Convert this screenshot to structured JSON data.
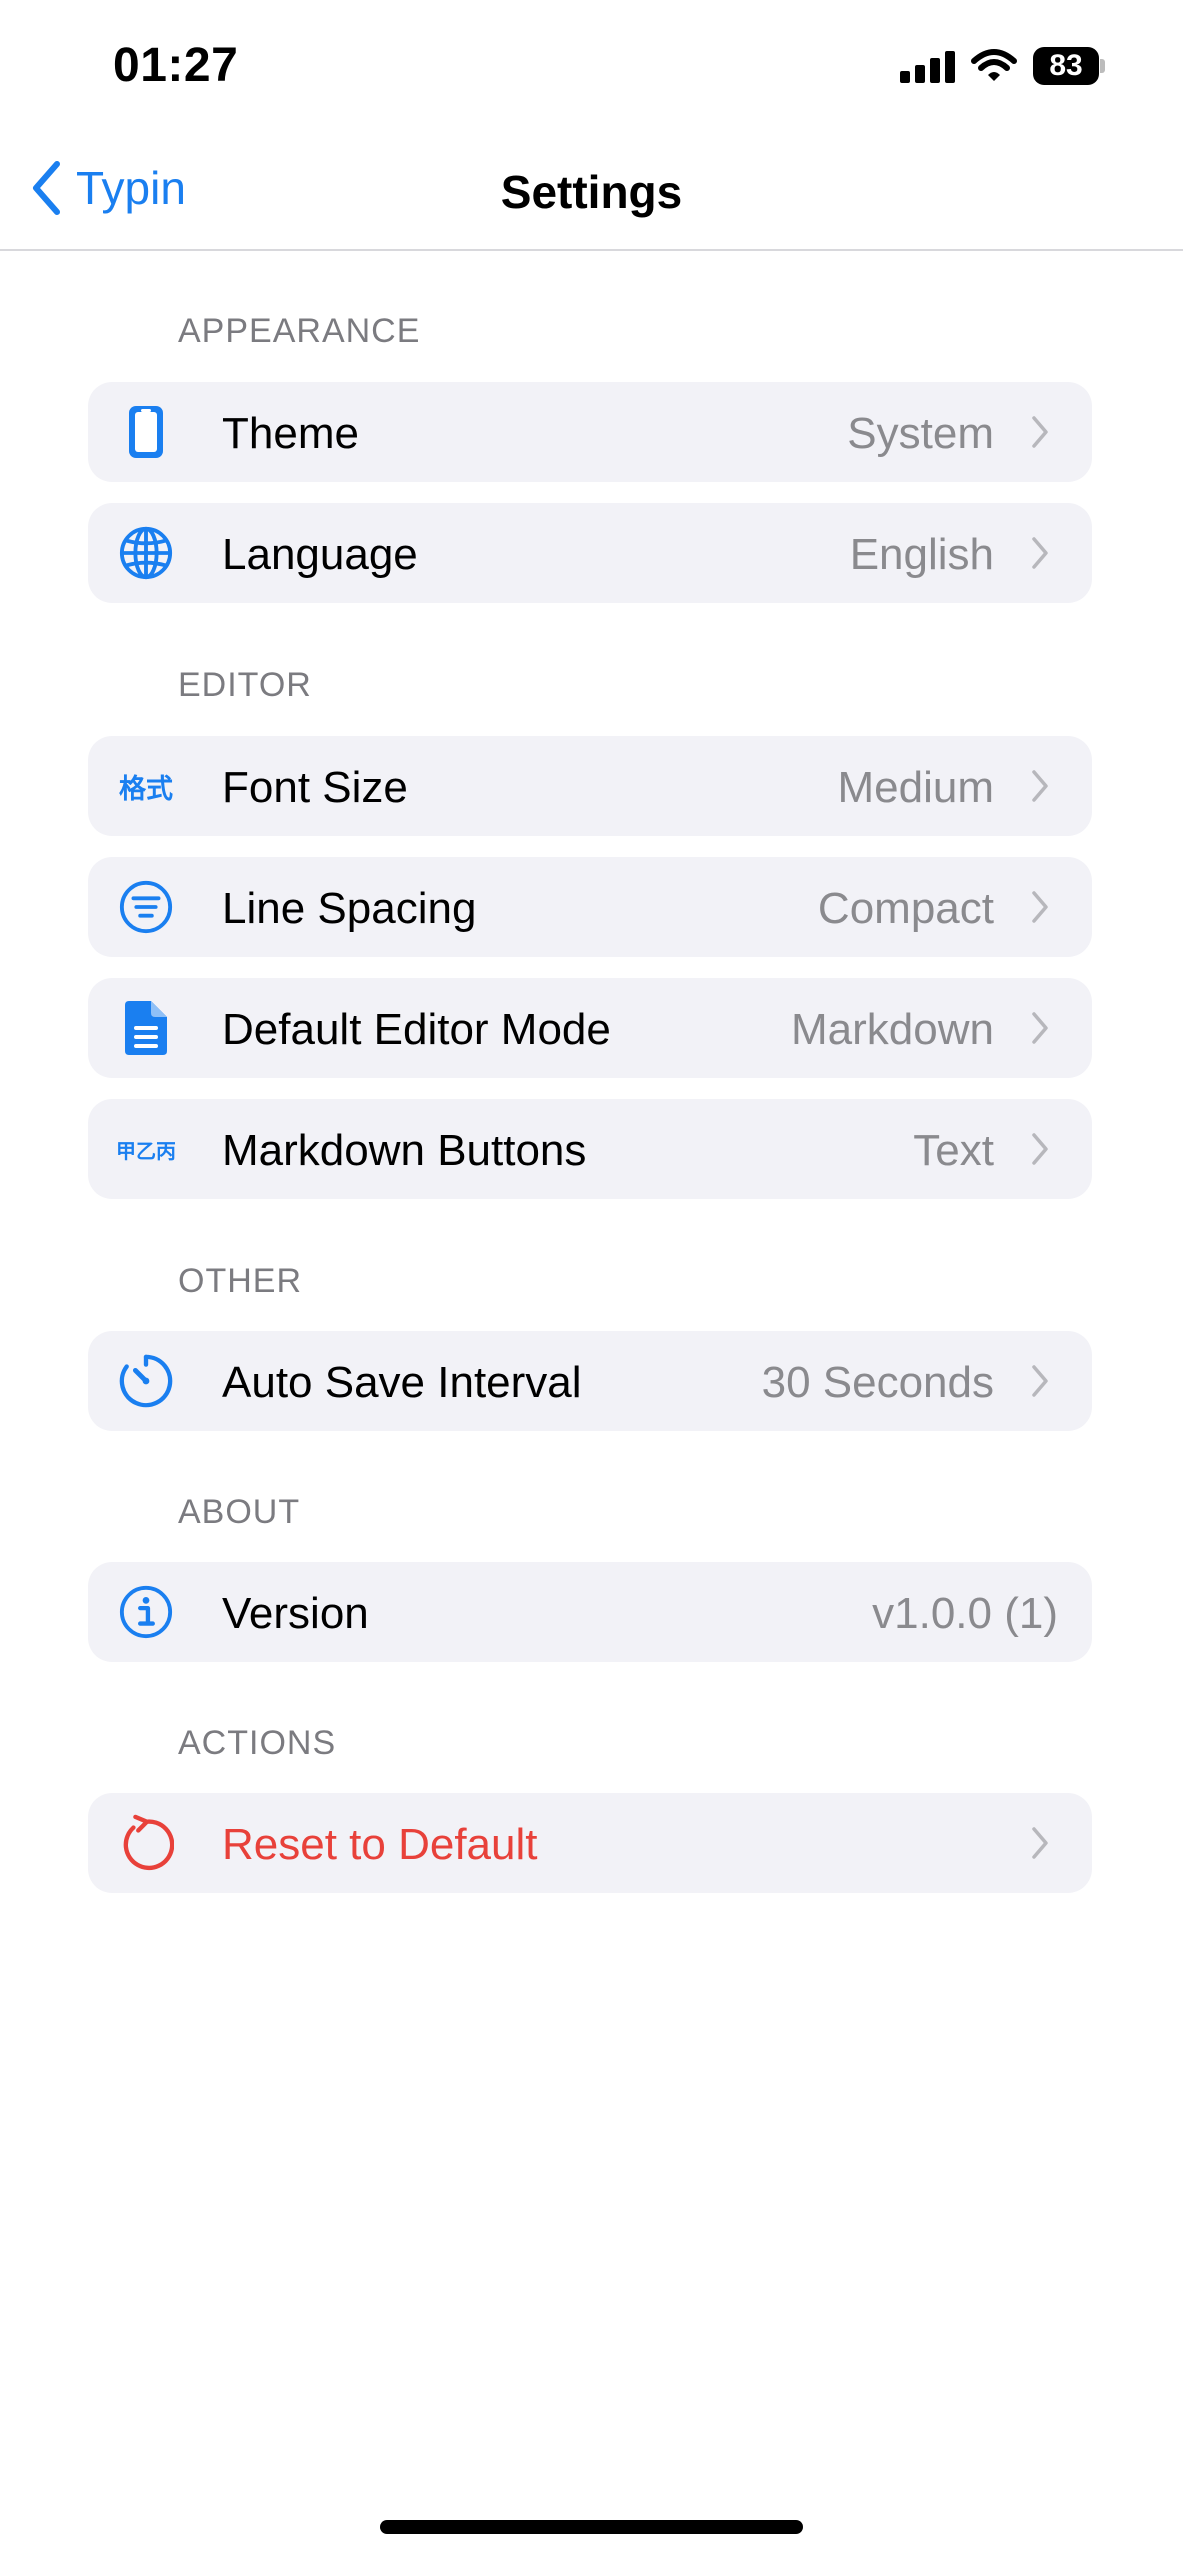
{
  "status_bar": {
    "time": "01:27",
    "battery_level": "83"
  },
  "nav": {
    "back_label": "Typin",
    "title": "Settings"
  },
  "sections": [
    {
      "header": "APPEARANCE",
      "rows": [
        {
          "icon": "phone-icon",
          "label": "Theme",
          "value": "System"
        },
        {
          "icon": "globe-icon",
          "label": "Language",
          "value": "English"
        }
      ]
    },
    {
      "header": "EDITOR",
      "rows": [
        {
          "icon": "format-glyph-icon",
          "glyph": "格式",
          "label": "Font Size",
          "value": "Medium"
        },
        {
          "icon": "line-spacing-icon",
          "label": "Line Spacing",
          "value": "Compact"
        },
        {
          "icon": "document-icon",
          "label": "Default Editor Mode",
          "value": "Markdown"
        },
        {
          "icon": "markdown-glyph-icon",
          "glyph": "甲乙丙",
          "label": "Markdown Buttons",
          "value": "Text"
        }
      ]
    },
    {
      "header": "OTHER",
      "rows": [
        {
          "icon": "timer-icon",
          "label": "Auto Save Interval",
          "value": "30 Seconds"
        }
      ]
    },
    {
      "header": "ABOUT",
      "rows": [
        {
          "icon": "info-icon",
          "label": "Version",
          "value": "v1.0.0 (1)"
        }
      ]
    },
    {
      "header": "ACTIONS",
      "rows": [
        {
          "icon": "reset-icon",
          "label": "Reset to Default"
        }
      ]
    }
  ],
  "colors": {
    "accent": "#1a7ff0",
    "danger": "#e8413a",
    "secondary_text": "#8a8a8e",
    "row_background": "#f2f2f7"
  }
}
